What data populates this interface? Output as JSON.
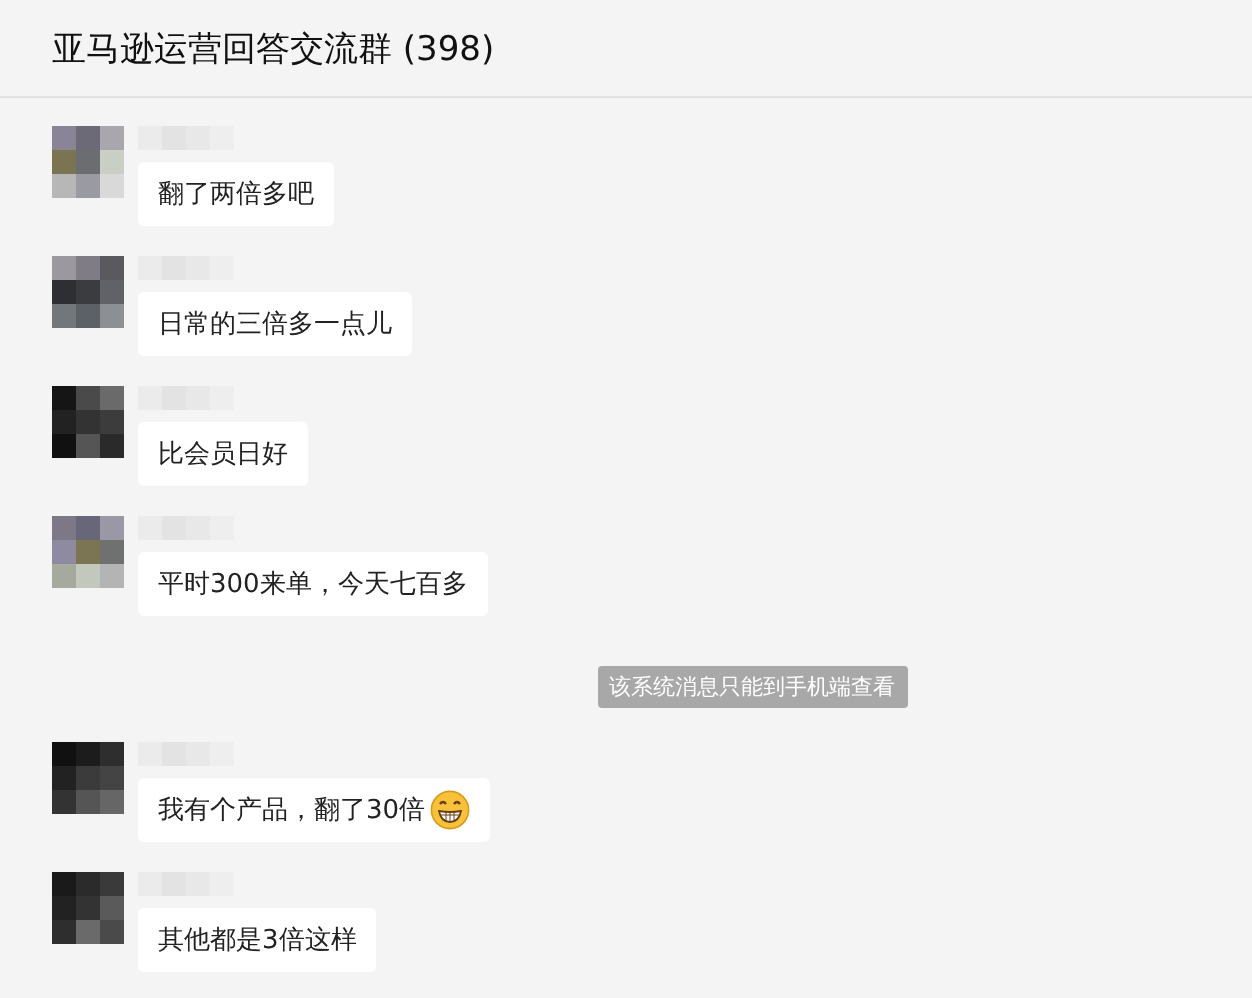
{
  "window": {
    "title": "亚马逊运营回答交流群 (398)"
  },
  "messages": [
    {
      "kind": "text",
      "text": "翻了两倍多吧"
    },
    {
      "kind": "text",
      "text": "日常的三倍多一点儿"
    },
    {
      "kind": "text",
      "text": "比会员日好"
    },
    {
      "kind": "text",
      "text": "平时300来单，今天七百多"
    },
    {
      "kind": "system",
      "text": "该系统消息只能到手机端查看"
    },
    {
      "kind": "text-with-emoji",
      "text": "我有个产品，翻了30倍"
    },
    {
      "kind": "text",
      "text": "其他都是3倍这样"
    }
  ]
}
